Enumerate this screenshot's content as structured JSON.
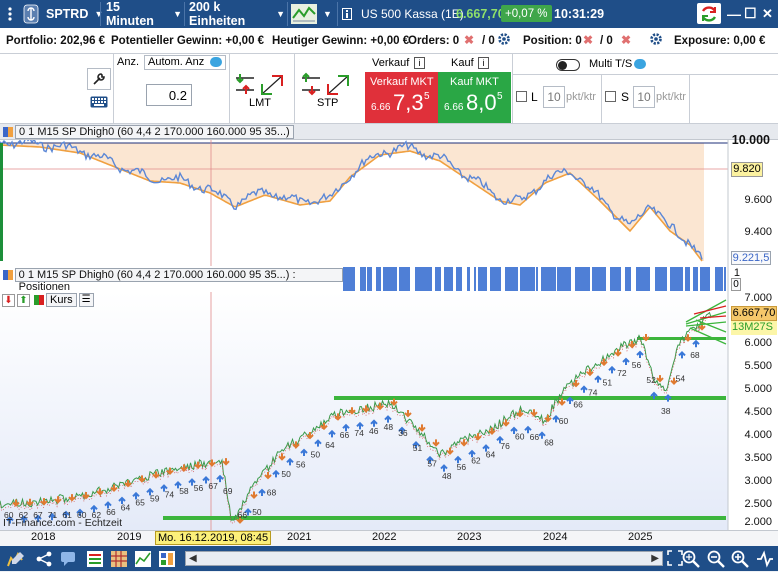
{
  "toolbar": {
    "symbol": "SPTRD",
    "interval": "15 Minuten",
    "units": "200 k Einheiten",
    "instrument": "US 500 Kassa (1E)",
    "price": "6.667,70",
    "change": "+0,07 %",
    "time": "10:31:29",
    "minimize": "—",
    "maximize": "☐",
    "close": "✕"
  },
  "info": {
    "portfolio": "Portfolio: 202,96 €",
    "potential_gain": "Potentieller Gewinn: +0,00 €",
    "today_gain": "Heutiger Gewinn: +0,00 €",
    "orders_label": "Orders: 0",
    "orders_suffix": "/ 0",
    "position_label": "Position: 0",
    "position_suffix": "/ 0",
    "exposure": "Exposure: 0,00 €"
  },
  "order": {
    "anz_label": "Anz.",
    "auto_anz": "Autom. Anz",
    "quantity": "0.2",
    "lmt": "LMT",
    "stp": "STP",
    "sell_header": "Verkauf",
    "buy_header": "Kauf",
    "sell_mkt": "Verkauf MKT",
    "sell_prefix": "6.66",
    "sell_big": "7,3",
    "sell_sup": "5",
    "buy_mkt": "Kauf MKT",
    "buy_prefix": "6.66",
    "buy_big": "8,0",
    "buy_sup": "5",
    "multi": "Multi T/S",
    "l_label": "L",
    "l_value": "10",
    "l_unit": "pkt/ktr",
    "s_label": "S",
    "s_value": "10",
    "s_unit": "pkt/ktr"
  },
  "panels": {
    "dhigh": "0 1 M15 SP Dhigh0 (60 4,4 2 170.000 160.000 95 35...)",
    "positions": "0 1 M15 SP Dhigh0 (60 4,4 2 170.000 160.000 95 35...) : Positionen",
    "kurs": "Kurs"
  },
  "dhigh_axis": [
    "10.000",
    "9.600",
    "9.400"
  ],
  "dhigh_current": "9.820",
  "dhigh_last": "9.221,5",
  "pos_axis": [
    "1",
    "0"
  ],
  "kurs_axis": [
    "7.000",
    "6.000",
    "5.500",
    "5.000",
    "4.500",
    "4.000",
    "3.500",
    "3.000",
    "2.500",
    "2.000"
  ],
  "kurs_price": "6.667,70",
  "kurs_timer": "13M27S",
  "years": [
    "2018",
    "2019",
    "2021",
    "2022",
    "2023",
    "2024",
    "2025"
  ],
  "cursor_date": "Mo. 16.12.2019, 08:45",
  "watermark": "IT-Finance.com - Echtzeit",
  "trade_labels_low": [
    "60",
    "62",
    "67",
    "71",
    "61",
    "60",
    "62",
    "66",
    "64",
    "65",
    "59",
    "74",
    "58",
    "56",
    "67",
    "69",
    "66",
    "50",
    "68",
    "50",
    "56",
    "50",
    "64",
    "66",
    "74",
    "46",
    "48",
    "36",
    "51",
    "57",
    "48",
    "56",
    "62",
    "64",
    "76",
    "60",
    "66",
    "68",
    "60",
    "66",
    "74",
    "51",
    "72",
    "56",
    "52",
    "38",
    "54",
    "68"
  ]
}
